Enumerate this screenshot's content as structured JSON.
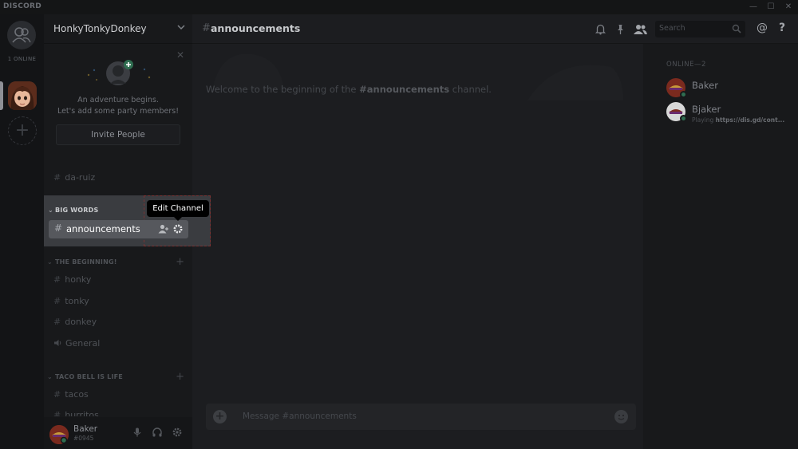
{
  "app": {
    "brand": "DISCORD"
  },
  "window": {
    "minimize": "—",
    "maximize": "☐",
    "close": "✕"
  },
  "guilds": {
    "online_label": "1 ONLINE",
    "add": "+"
  },
  "server": {
    "name": "HonkyTonkyDonkey",
    "chevron": "⌄"
  },
  "invite": {
    "close": "✕",
    "line1": "An adventure begins.",
    "line2": "Let's add some party members!",
    "button": "Invite People"
  },
  "channels": {
    "top": [
      {
        "name": "da-ruiz"
      }
    ],
    "big_words": {
      "label": "BIG WORDS",
      "channels": [
        {
          "name": "announcements"
        }
      ]
    },
    "beginning": {
      "label": "THE BEGINNING!",
      "channels": [
        {
          "name": "honky",
          "kind": "text"
        },
        {
          "name": "tonky",
          "kind": "text"
        },
        {
          "name": "donkey",
          "kind": "text"
        },
        {
          "name": "General",
          "kind": "voice"
        }
      ]
    },
    "taco": {
      "label": "TACO BELL IS LIFE",
      "channels": [
        {
          "name": "tacos"
        },
        {
          "name": "burritos"
        }
      ]
    }
  },
  "tooltip": {
    "text": "Edit Channel"
  },
  "user": {
    "name": "Baker",
    "discriminator": "#0945"
  },
  "topbar": {
    "channel": "announcements",
    "search_placeholder": "Search",
    "mention": "@",
    "help": "?"
  },
  "chat": {
    "welcome_prefix": "Welcome to the beginning of the ",
    "welcome_channel": "#announcements",
    "welcome_suffix": " channel.",
    "compose_placeholder": "Message #announcements"
  },
  "members": {
    "header": "ONLINE—2",
    "list": [
      {
        "name": "Baker",
        "status_prefix": "",
        "status_game": ""
      },
      {
        "name": "Bjaker",
        "status_prefix": "Playing ",
        "status_game": "https://dis.gd/cont..."
      }
    ]
  },
  "colors": {
    "online": "#2f6d50",
    "tooltip_bg": "#000000",
    "highlight_row": "#56585d"
  }
}
